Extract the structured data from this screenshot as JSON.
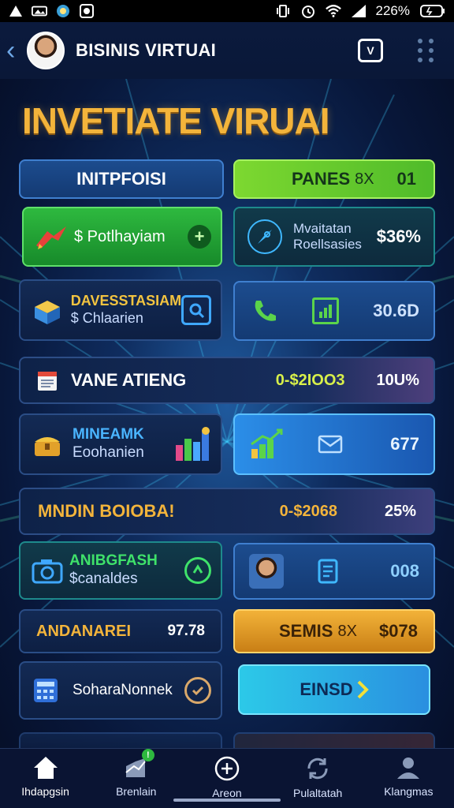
{
  "status_bar": {
    "battery_text": "226%"
  },
  "header": {
    "title": "BISINIS VIRTUAI",
    "action_badge": "V"
  },
  "headline": "INVETIATE VIRUAI",
  "cards": {
    "top_left_label": "INITPFOISI",
    "top_right_label": "PANES",
    "top_right_suffix": "8X",
    "top_right_value": "01",
    "payout_label": "$ Potlhayiam",
    "motivation_line1": "Mvaitatan",
    "motivation_line2": "Roellsasies",
    "motivation_value": "$36%",
    "invest_line1": "DAVESSTASIAM",
    "invest_line2": "$ Chlaarien",
    "phone_value": "30.6D",
    "row1_title": "VANE ATIENG",
    "row1_range": "0-$2IOO3",
    "row1_pct": "10U%",
    "mine_line1": "MINEAMK",
    "mine_line2": "Eoohanien",
    "growth_value": "677",
    "row2_title": "MNDIN BOIOBA!",
    "row2_range": "0-$2068",
    "row2_pct": "25%",
    "angr_line1": "ANIBGFASH",
    "angr_line2": "$canaldes",
    "person_value": "008",
    "andan_label": "ANDANAREI",
    "andan_value": "97.78",
    "semis_label": "SEMIS",
    "semis_suffix": "8X",
    "semis_value": "$078",
    "sohar_label": "SoharaNonnek",
    "einso_label": "EINSD"
  },
  "bottom_nav": [
    {
      "label": "Ihdapgsin",
      "icon": "home-icon"
    },
    {
      "label": "Brenlain",
      "icon": "chart-icon",
      "badge": "!"
    },
    {
      "label": "Areon",
      "icon": "plus-circle-icon"
    },
    {
      "label": "Pulaltatah",
      "icon": "refresh-icon"
    },
    {
      "label": "Klangmas",
      "icon": "profile-icon"
    }
  ],
  "colors": {
    "accent_gold": "#f3b43b",
    "accent_green": "#2eb93f",
    "accent_cyan": "#2cc9e8",
    "bg_navy": "#08173a"
  }
}
